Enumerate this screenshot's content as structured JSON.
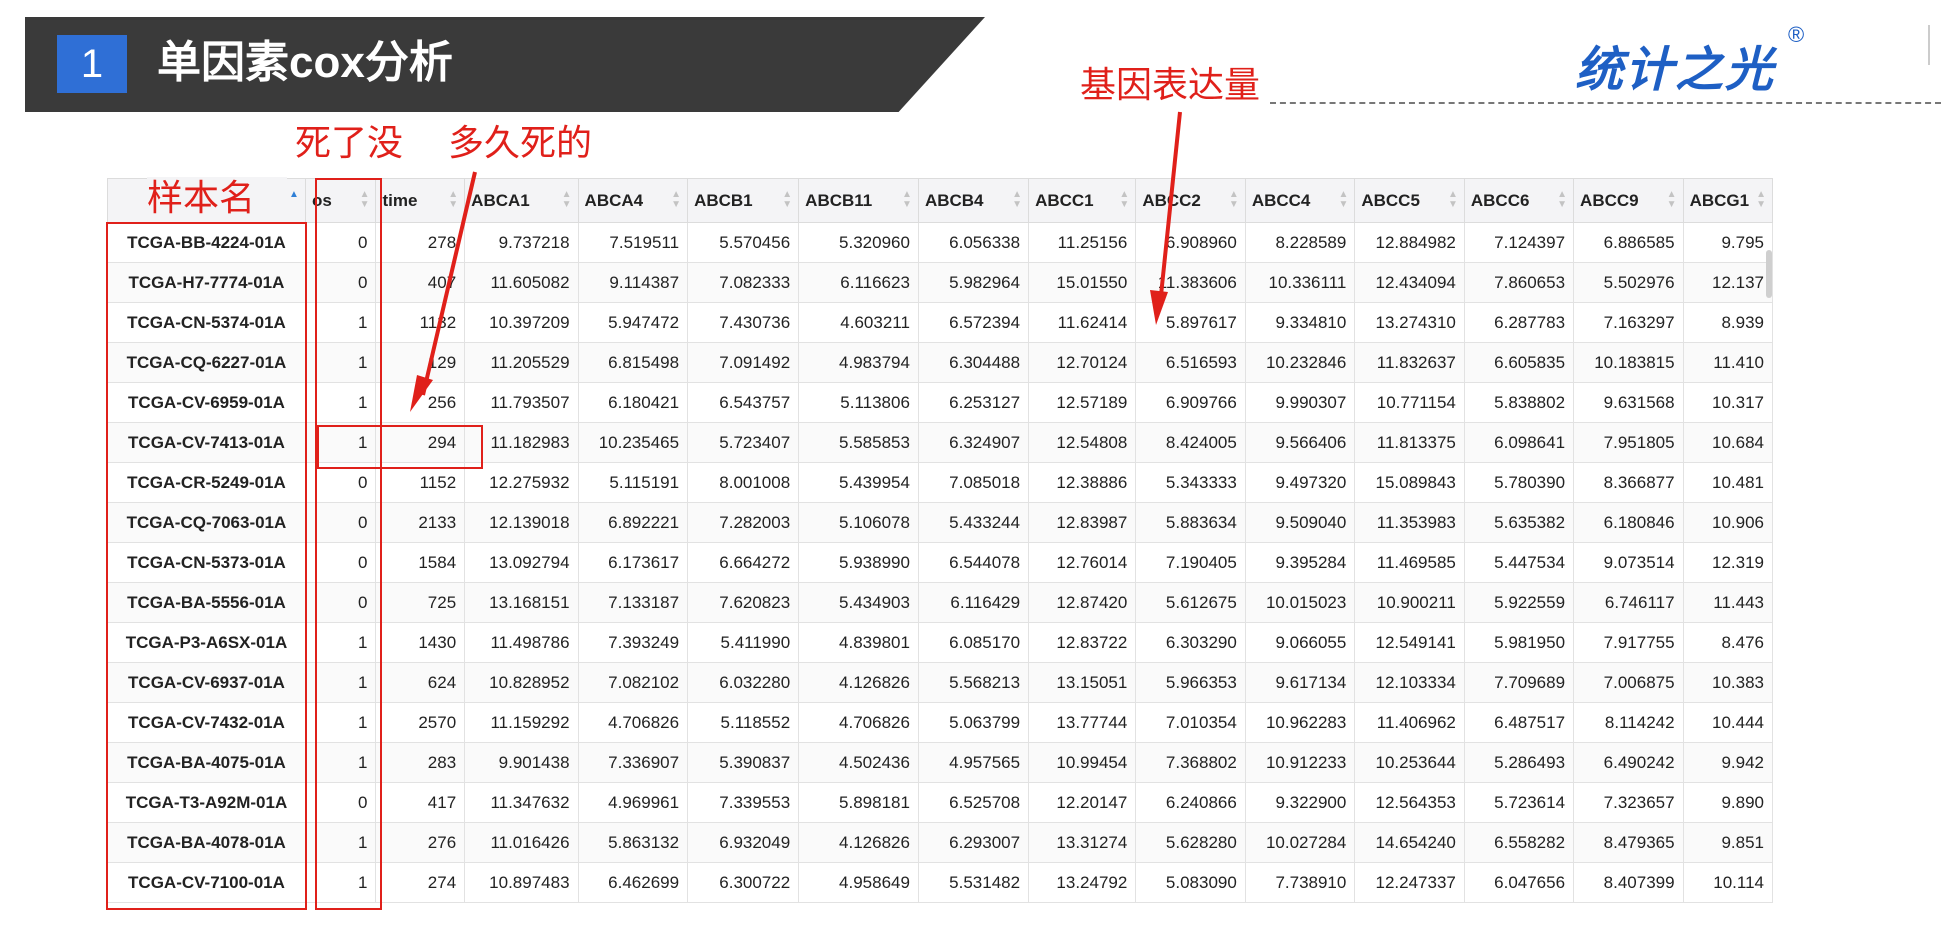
{
  "header": {
    "badge": "1",
    "title": "单因素cox分析"
  },
  "logo": {
    "text": "统计之光",
    "reg": "®"
  },
  "annotations": {
    "sample_name": "样本名",
    "dead": "死了没",
    "how_long": "多久死的",
    "gene_expr": "基因表达量"
  },
  "colors": {
    "banner": "#3a3a3a",
    "badge": "#2f6fd6",
    "annotation": "#e0201a",
    "logo": "#1e5fc4"
  },
  "table": {
    "columns": [
      "",
      "os",
      "time",
      "ABCA1",
      "ABCA4",
      "ABCB1",
      "ABCB11",
      "ABCB4",
      "ABCC1",
      "ABCC2",
      "ABCC4",
      "ABCC5",
      "ABCC6",
      "ABCC9",
      "ABCG1"
    ],
    "rows": [
      [
        "TCGA-BB-4224-01A",
        "0",
        "278",
        "9.737218",
        "7.519511",
        "5.570456",
        "5.320960",
        "6.056338",
        "11.25156",
        "6.908960",
        "8.228589",
        "12.884982",
        "7.124397",
        "6.886585",
        "9.795"
      ],
      [
        "TCGA-H7-7774-01A",
        "0",
        "407",
        "11.605082",
        "9.114387",
        "7.082333",
        "6.116623",
        "5.982964",
        "15.01550",
        "11.383606",
        "10.336111",
        "12.434094",
        "7.860653",
        "5.502976",
        "12.137"
      ],
      [
        "TCGA-CN-5374-01A",
        "1",
        "1132",
        "10.397209",
        "5.947472",
        "7.430736",
        "4.603211",
        "6.572394",
        "11.62414",
        "5.897617",
        "9.334810",
        "13.274310",
        "6.287783",
        "7.163297",
        "8.939"
      ],
      [
        "TCGA-CQ-6227-01A",
        "1",
        "129",
        "11.205529",
        "6.815498",
        "7.091492",
        "4.983794",
        "6.304488",
        "12.70124",
        "6.516593",
        "10.232846",
        "11.832637",
        "6.605835",
        "10.183815",
        "11.410"
      ],
      [
        "TCGA-CV-6959-01A",
        "1",
        "256",
        "11.793507",
        "6.180421",
        "6.543757",
        "5.113806",
        "6.253127",
        "12.57189",
        "6.909766",
        "9.990307",
        "10.771154",
        "5.838802",
        "9.631568",
        "10.317"
      ],
      [
        "TCGA-CV-7413-01A",
        "1",
        "294",
        "11.182983",
        "10.235465",
        "5.723407",
        "5.585853",
        "6.324907",
        "12.54808",
        "8.424005",
        "9.566406",
        "11.813375",
        "6.098641",
        "7.951805",
        "10.684"
      ],
      [
        "TCGA-CR-5249-01A",
        "0",
        "1152",
        "12.275932",
        "5.115191",
        "8.001008",
        "5.439954",
        "7.085018",
        "12.38886",
        "5.343333",
        "9.497320",
        "15.089843",
        "5.780390",
        "8.366877",
        "10.481"
      ],
      [
        "TCGA-CQ-7063-01A",
        "0",
        "2133",
        "12.139018",
        "6.892221",
        "7.282003",
        "5.106078",
        "5.433244",
        "12.83987",
        "5.883634",
        "9.509040",
        "11.353983",
        "5.635382",
        "6.180846",
        "10.906"
      ],
      [
        "TCGA-CN-5373-01A",
        "0",
        "1584",
        "13.092794",
        "6.173617",
        "6.664272",
        "5.938990",
        "6.544078",
        "12.76014",
        "7.190405",
        "9.395284",
        "11.469585",
        "5.447534",
        "9.073514",
        "12.319"
      ],
      [
        "TCGA-BA-5556-01A",
        "0",
        "725",
        "13.168151",
        "7.133187",
        "7.620823",
        "5.434903",
        "6.116429",
        "12.87420",
        "5.612675",
        "10.015023",
        "10.900211",
        "5.922559",
        "6.746117",
        "11.443"
      ],
      [
        "TCGA-P3-A6SX-01A",
        "1",
        "1430",
        "11.498786",
        "7.393249",
        "5.411990",
        "4.839801",
        "6.085170",
        "12.83722",
        "6.303290",
        "9.066055",
        "12.549141",
        "5.981950",
        "7.917755",
        "8.476"
      ],
      [
        "TCGA-CV-6937-01A",
        "1",
        "624",
        "10.828952",
        "7.082102",
        "6.032280",
        "4.126826",
        "5.568213",
        "13.15051",
        "5.966353",
        "9.617134",
        "12.103334",
        "7.709689",
        "7.006875",
        "10.383"
      ],
      [
        "TCGA-CV-7432-01A",
        "1",
        "2570",
        "11.159292",
        "4.706826",
        "5.118552",
        "4.706826",
        "5.063799",
        "13.77744",
        "7.010354",
        "10.962283",
        "11.406962",
        "6.487517",
        "8.114242",
        "10.444"
      ],
      [
        "TCGA-BA-4075-01A",
        "1",
        "283",
        "9.901438",
        "7.336907",
        "5.390837",
        "4.502436",
        "4.957565",
        "10.99454",
        "7.368802",
        "10.912233",
        "10.253644",
        "5.286493",
        "6.490242",
        "9.942"
      ],
      [
        "TCGA-T3-A92M-01A",
        "0",
        "417",
        "11.347632",
        "4.969961",
        "7.339553",
        "5.898181",
        "6.525708",
        "12.20147",
        "6.240866",
        "9.322900",
        "12.564353",
        "5.723614",
        "7.323657",
        "9.890"
      ],
      [
        "TCGA-BA-4078-01A",
        "1",
        "276",
        "11.016426",
        "5.863132",
        "6.932049",
        "4.126826",
        "6.293007",
        "13.31274",
        "5.628280",
        "10.027284",
        "14.654240",
        "6.558282",
        "8.479365",
        "9.851"
      ],
      [
        "TCGA-CV-7100-01A",
        "1",
        "274",
        "10.897483",
        "6.462699",
        "6.300722",
        "4.958649",
        "5.531482",
        "13.24792",
        "5.083090",
        "7.738910",
        "12.247337",
        "6.047656",
        "8.407399",
        "10.114"
      ]
    ]
  }
}
